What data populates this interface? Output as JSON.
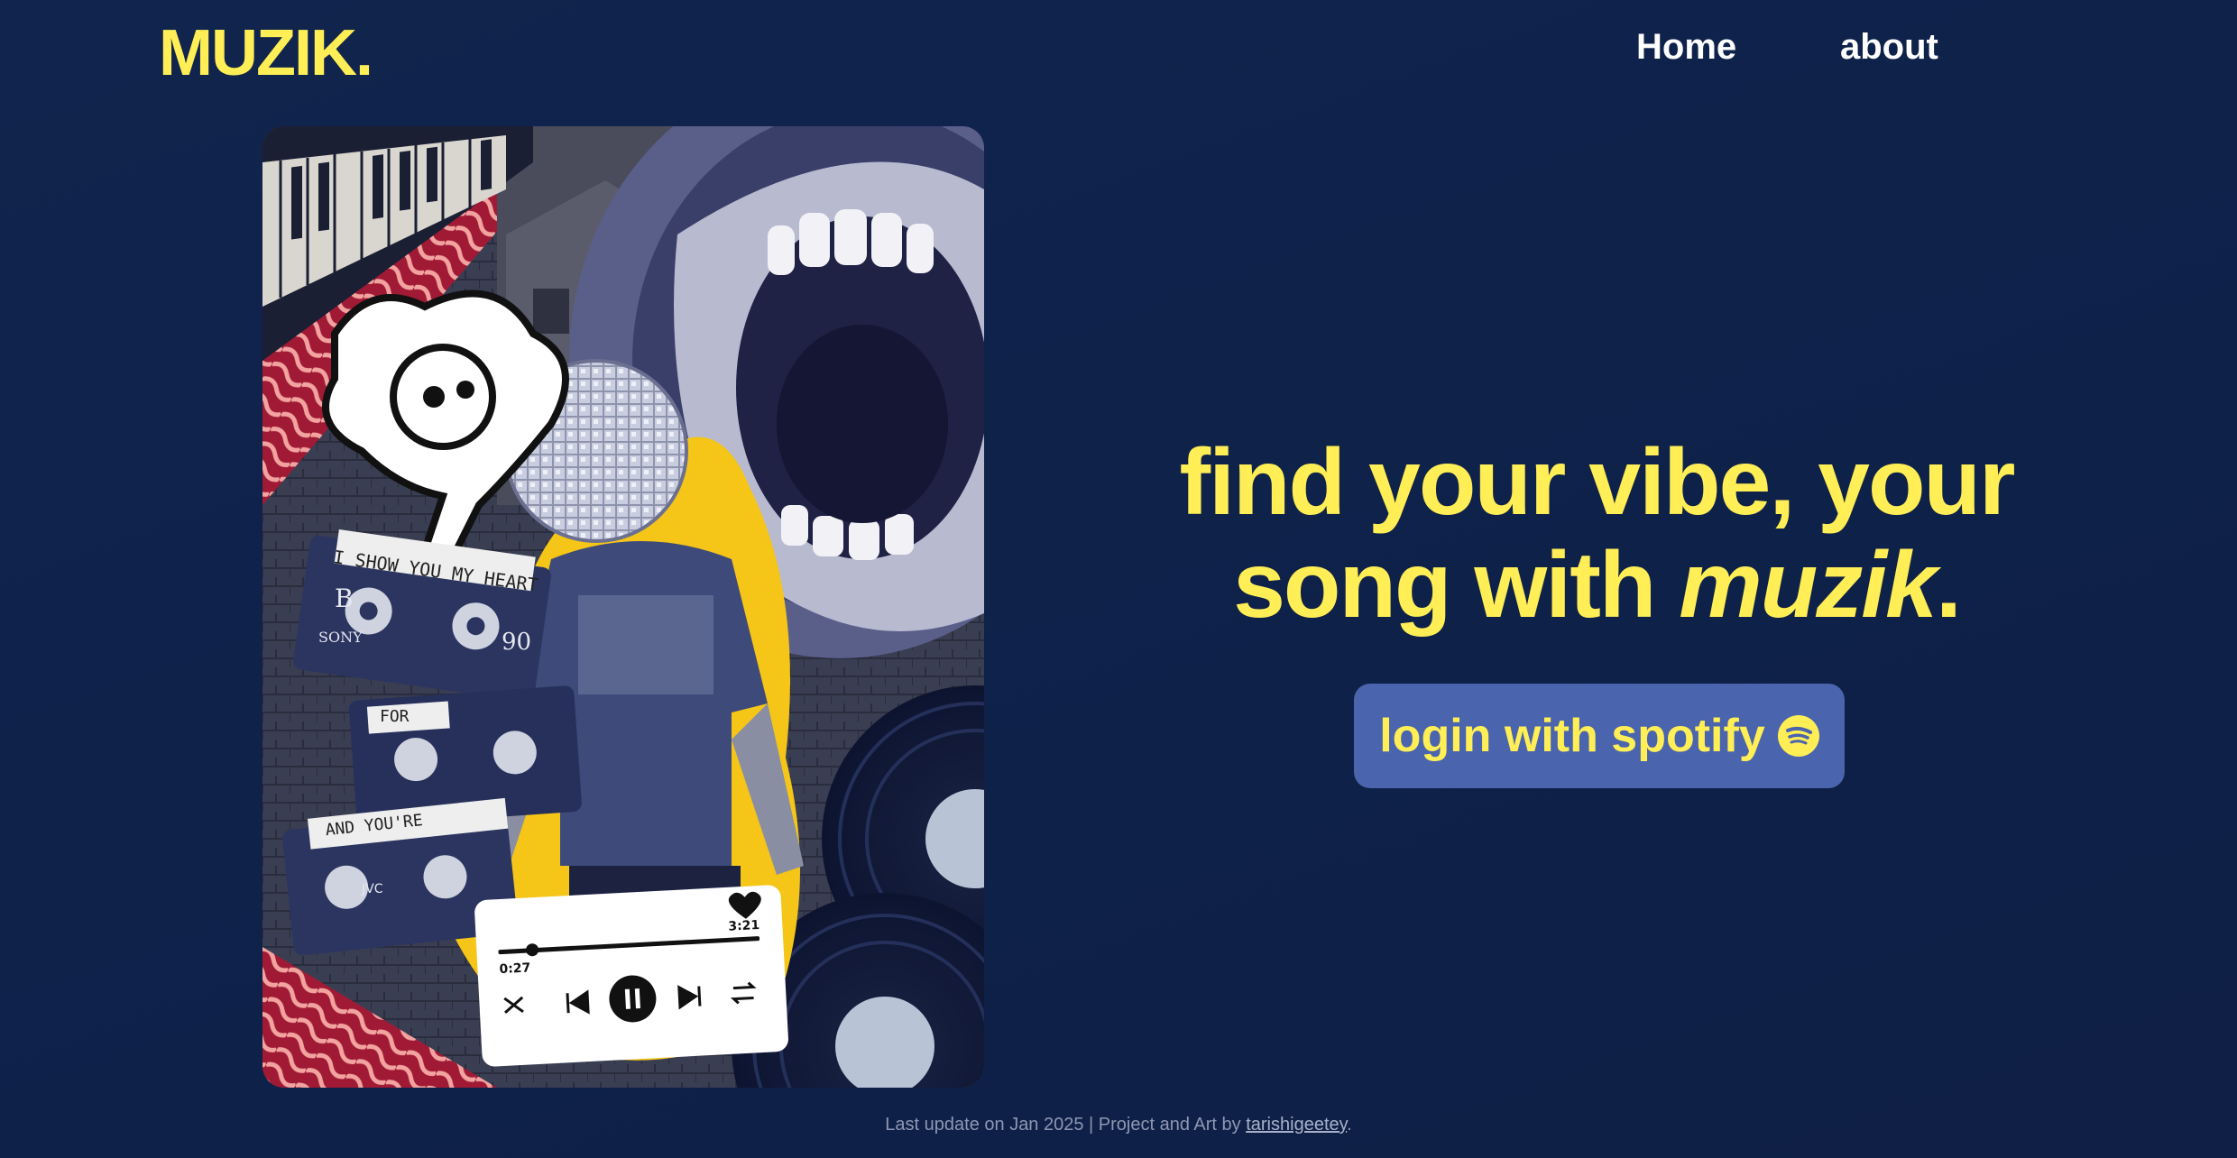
{
  "header": {
    "logo": "MUZIK.",
    "nav": {
      "home": "Home",
      "about": "about"
    }
  },
  "collage": {
    "tape_label_1": "I SHOW YOU MY HEART",
    "tape_brand": "SONY",
    "tape_number": "90",
    "tape_letter": "B",
    "tape_label_2": "FOR",
    "tape_label_3": "AND YOU'RE",
    "tape_brand_2": "JVC",
    "player": {
      "elapsed": "0:27",
      "duration": "3:21",
      "progress": 0.13
    }
  },
  "hero": {
    "headline_line1": "find your vibe, your",
    "headline_line2_pre": "song with ",
    "headline_brand": "muzik",
    "headline_end": ".",
    "cta": "login with spotify"
  },
  "footer": {
    "text": "Last update on Jan 2025 | Project and Art by ",
    "author": "tarishigeetey",
    "end": "."
  },
  "colors": {
    "background": "#0f2248",
    "accent_yellow": "#ffee55",
    "button_blue": "#4a64ad"
  }
}
